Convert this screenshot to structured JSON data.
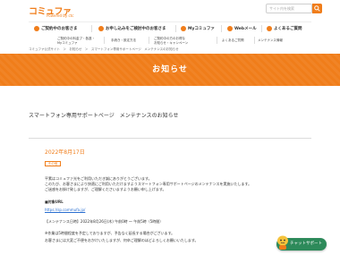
{
  "header": {
    "logo_main": "コミュファ",
    "logo_sub": "Powered by ctc",
    "search_placeholder": "サイト内を検索"
  },
  "main_nav": [
    {
      "label": "ご契約中のお客さま"
    },
    {
      "label": "お申し込みをご検討中のお客さま"
    },
    {
      "label": "Myコミュファ"
    },
    {
      "label": "Webメール"
    },
    {
      "label": "よくあるご質問"
    }
  ],
  "sub_nav": [
    {
      "label": "ご契約中の料金プ・各遂・\nMyコミュファ"
    },
    {
      "label": "手続き・設定方法"
    },
    {
      "label": "ご契約中の方のお得な\nお知らせ・キャンペーン"
    },
    {
      "label": "よくあるご質問"
    },
    {
      "label": "メンテナンス情報"
    }
  ],
  "breadcrumb": "コミュファ公式サイト　＞　お知らせ　＞　スマートフォン専用サポートページ　メンテナンスのお知らせ",
  "banner": {
    "title": "お知らせ"
  },
  "article": {
    "title": "スマートフォン専用サポートページ　メンテナンスのお知らせ",
    "date": "2022年8月17日",
    "tag": "その他",
    "lines": [
      "平素はコミュファ光をご利用いただき誠にありがとうございます。",
      "このたび、お客さまにより快適にご利用いただけますようスマートフォン専用サポートページのメンテナンスを実施いたします。",
      "ご迷惑をお掛け致しますが、ご理解くださいますようお願い申し上げます。",
      "■対象URL",
      "https://sp.commufa.jp/",
      "【メンテナンス日時】2022年8月26日(木) 午前0時 〜 午前5時（5時間）",
      "※作業は5時間程度を予定しておりますが、予告なく延長する場合がございます。",
      "お客さまには大変ご不便をおかけいたしますが、何卒ご理解のほどよろしくお願いいたします。"
    ]
  },
  "assistant": {
    "label": "チャットサポート"
  },
  "colors": {
    "accent": "#f07d1a",
    "assist": "#2d8a5a"
  }
}
